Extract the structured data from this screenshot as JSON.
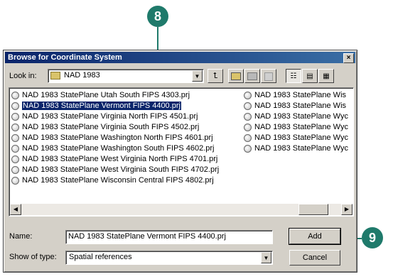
{
  "callouts": {
    "top": "8",
    "right": "9"
  },
  "dialog": {
    "title": "Browse for Coordinate System",
    "close_glyph": "×",
    "look_in_label": "Look in:",
    "look_in_value": "NAD 1983",
    "look_in_icon": "folder-globe-icon",
    "toolbar": {
      "up_icon": "up-one-level-icon",
      "connect_icon": "connect-folder-icon",
      "disconnect_icon": "disconnect-folder-icon",
      "new_icon": "new-item-icon",
      "list_icon": "list-view-icon",
      "details_icon": "details-view-icon",
      "thumbnails_icon": "thumbnails-view-icon"
    },
    "files_col1": [
      "NAD 1983 StatePlane Utah South FIPS 4303.prj",
      "NAD 1983 StatePlane Vermont FIPS 4400.prj",
      "NAD 1983 StatePlane Virginia North FIPS 4501.prj",
      "NAD 1983 StatePlane Virginia South FIPS 4502.prj",
      "NAD 1983 StatePlane Washington North FIPS 4601.prj",
      "NAD 1983 StatePlane Washington South FIPS 4602.prj",
      "NAD 1983 StatePlane West Virginia North FIPS 4701.prj",
      "NAD 1983 StatePlane West Virginia South FIPS 4702.prj",
      "NAD 1983 StatePlane Wisconsin Central FIPS 4802.prj"
    ],
    "files_col2": [
      "NAD 1983 StatePlane Wis",
      "NAD 1983 StatePlane Wis",
      "NAD 1983 StatePlane Wyc",
      "NAD 1983 StatePlane Wyc",
      "NAD 1983 StatePlane Wyc",
      "NAD 1983 StatePlane Wyc"
    ],
    "selected_index": 1,
    "name_label": "Name:",
    "name_value": "NAD 1983 StatePlane Vermont FIPS 4400.prj",
    "type_label": "Show of type:",
    "type_value": "Spatial references",
    "add_label": "Add",
    "cancel_label": "Cancel"
  }
}
